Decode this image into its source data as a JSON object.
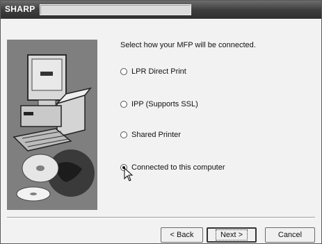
{
  "window": {
    "brand": "SHARP",
    "title_text": ""
  },
  "main": {
    "prompt": "Select how your MFP will be connected.",
    "options": [
      {
        "label": "LPR Direct Print",
        "selected": false
      },
      {
        "label": "IPP (Supports SSL)",
        "selected": false
      },
      {
        "label": "Shared Printer",
        "selected": false
      },
      {
        "label": "Connected to this computer",
        "selected": true
      }
    ]
  },
  "buttons": {
    "back": "< Back",
    "next": "Next >",
    "cancel": "Cancel"
  },
  "icons": {
    "sidebar_art": "computer-and-discs-illustration",
    "cursor": "mouse-pointer-icon"
  }
}
